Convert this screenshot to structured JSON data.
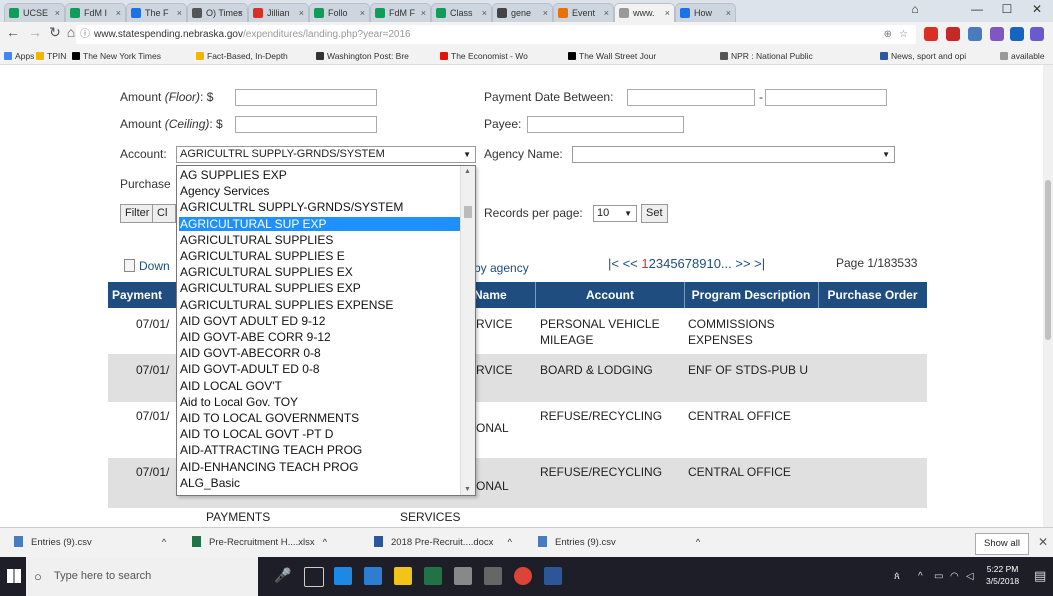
{
  "browser": {
    "tabs": [
      {
        "label": "UCSE",
        "color": "#0f9d58"
      },
      {
        "label": "FdM I",
        "color": "#0f9d58"
      },
      {
        "label": "The F",
        "color": "#1a73e8"
      },
      {
        "label": "O) Times",
        "color": "#555555"
      },
      {
        "label": "Jillian",
        "color": "#d93025"
      },
      {
        "label": "Follo",
        "color": "#0f9d58"
      },
      {
        "label": "FdM F",
        "color": "#0f9d58"
      },
      {
        "label": "Class",
        "color": "#0f9d58"
      },
      {
        "label": "gene",
        "color": "#444444"
      },
      {
        "label": "Event",
        "color": "#e8710a"
      },
      {
        "label": "www.",
        "color": "#999999",
        "active": true
      },
      {
        "label": "How",
        "color": "#1a73e8"
      }
    ],
    "url_host": "www.statespending.nebraska.gov",
    "url_path": "/expenditures/landing.php?year=2016",
    "bookmarks": [
      {
        "label": "Apps",
        "color": "#4285f4"
      },
      {
        "label": "TPIN",
        "color": "#f4b400"
      },
      {
        "label": "The New York Times",
        "color": "#000000"
      },
      {
        "label": "Fact-Based, In-Depth",
        "color": "#f4b400"
      },
      {
        "label": "Washington Post: Bre",
        "color": "#333333"
      },
      {
        "label": "The Economist - Wo",
        "color": "#e3120b"
      },
      {
        "label": "The Wall Street Jour",
        "color": "#000000"
      },
      {
        "label": "NPR : National Public",
        "color": "#555555"
      },
      {
        "label": "News, sport and opi",
        "color": "#2c5aa0"
      },
      {
        "label": "available",
        "color": "#999999"
      }
    ]
  },
  "form": {
    "amount_floor_label": "Amount ",
    "amount_floor_em": "(Floor)",
    "amount_floor_suffix": ": $",
    "amount_ceiling_label": "Amount ",
    "amount_ceiling_em": "(Ceiling)",
    "amount_ceiling_suffix": ": $",
    "payment_date_label": "Payment Date Between:",
    "date_dash": "-",
    "payee_label": "Payee:",
    "account_label": "Account:",
    "account_value": "AGRICULTRL SUPPLY-GRNDS/SYSTEM",
    "agency_label": "Agency Name:",
    "purchase_label": "Purchase",
    "filter_label": "Filter",
    "clear_label": "Cl",
    "records_label": "Records per page:",
    "records_value": "10",
    "set_label": "Set"
  },
  "results": {
    "download_label": "Down",
    "by_agency_label": "by agency",
    "pager_prev": "|< <<",
    "pager_current": "1",
    "pager_pages": "2345678910...",
    "pager_next": ">> >|",
    "page_info": "Page 1/183533",
    "headers": [
      "Payment",
      "Name",
      "Account",
      "Program Description",
      "Purchase Order"
    ],
    "rows": [
      {
        "date": "07/01/",
        "name": "RVICE",
        "account": "PERSONAL VEHICLE MILEAGE",
        "program": "COMMISSIONS EXPENSES",
        "grey": false
      },
      {
        "date": "07/01/",
        "name": "RVICE",
        "account": "BOARD & LODGING",
        "program": "ENF OF STDS-PUB U",
        "grey": true
      },
      {
        "date": "07/01/",
        "name": "ONAL",
        "account": "REFUSE/RECYCLING",
        "program": "CENTRAL OFFICE",
        "grey": false
      },
      {
        "date": "07/01/",
        "name": "ONAL",
        "account": "REFUSE/RECYCLING",
        "program": "CENTRAL OFFICE",
        "grey": true
      }
    ],
    "overflow_left": "PAYMENTS",
    "overflow_right": "SERVICES"
  },
  "dropdown": {
    "options": [
      "AG SUPPLIES EXP",
      "Agency Services",
      "AGRICULTRL SUPPLY-GRNDS/SYSTEM",
      "AGRICULTURAL SUP EXP",
      "AGRICULTURAL SUPPLIES",
      "AGRICULTURAL SUPPLIES E",
      "AGRICULTURAL SUPPLIES EX",
      "AGRICULTURAL SUPPLIES EXP",
      "AGRICULTURAL SUPPLIES EXPENSE",
      "AID GOVT ADULT ED 9-12",
      "AID GOVT-ABE CORR 9-12",
      "AID GOVT-ABECORR 0-8",
      "AID GOVT-ADULT ED 0-8",
      "AID LOCAL GOV'T",
      "Aid to Local Gov. TOY",
      "AID TO LOCAL GOVERNMENTS",
      "AID TO LOCAL GOVT -PT D",
      "AID-ATTRACTING TEACH PROG",
      "AID-ENHANCING TEACH PROG",
      "ALG_Basic"
    ],
    "highlighted_index": 3
  },
  "downloads": [
    "Entries (9).csv",
    "Pre-Recruitment H....xlsx",
    "2018 Pre-Recruit....docx",
    "Entries (9).csv"
  ],
  "downloads_show_all": "Show all",
  "taskbar": {
    "search_placeholder": "Type here to search",
    "time": "5:22 PM",
    "date": "3/5/2018"
  },
  "colors": {
    "table_header": "#1f4d80",
    "highlight": "#1e90ff",
    "pager_current": "#d0332b"
  }
}
